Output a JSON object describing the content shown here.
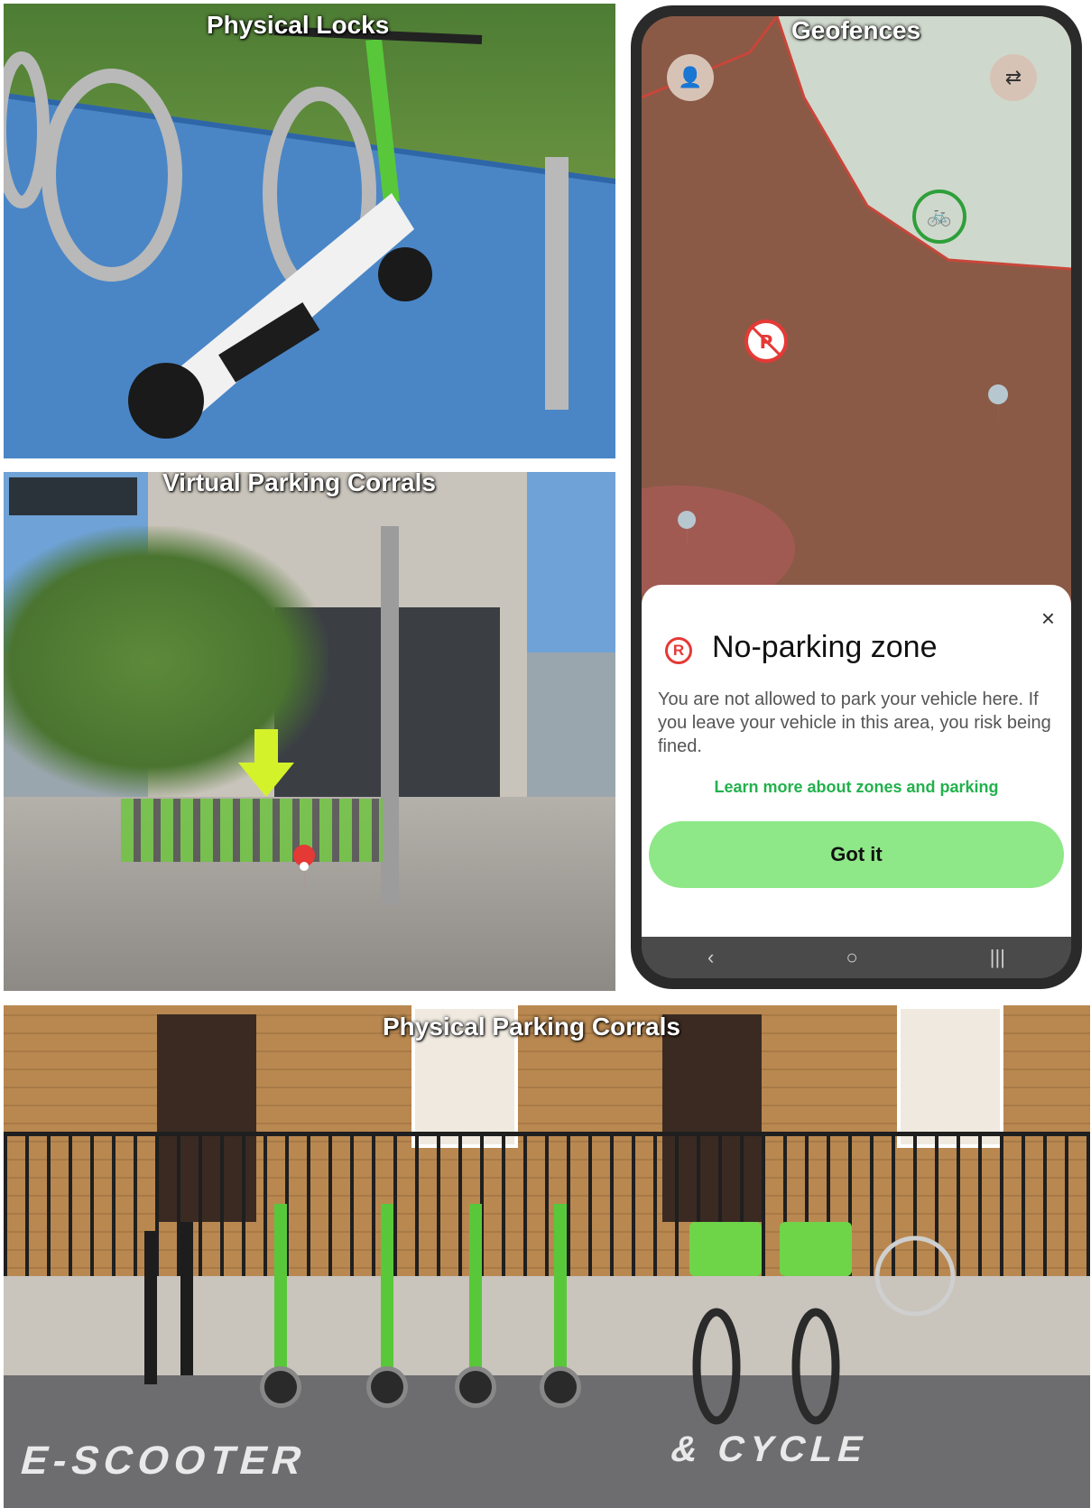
{
  "panels": {
    "physical_locks": {
      "caption": "Physical Locks"
    },
    "virtual_corrals": {
      "caption": "Virtual Parking Corrals"
    },
    "geofences": {
      "caption": "Geofences"
    },
    "physical_corrals": {
      "caption": "Physical Parking Corrals"
    }
  },
  "app": {
    "sheet": {
      "icon_glyph": "R",
      "title": "No-parking zone",
      "description": "You are not allowed to park your vehicle here. If you leave your vehicle in this area, you risk being fined.",
      "learn_more": "Learn more about zones and parking",
      "confirm_label": "Got it",
      "close_glyph": "×"
    },
    "map_icons": {
      "profile": "person-icon",
      "filter": "filter-icon",
      "bike": "bicycle-icon",
      "no_parking_pin": "no-parking-pin-icon",
      "location_pin": "location-pin-icon"
    },
    "navbar": {
      "back": "‹",
      "home": "○",
      "recents": "|||"
    }
  },
  "road_marking": {
    "left": "E-SCOOTER",
    "right": "& CYCLE"
  },
  "colors": {
    "accent_green": "#8ee888",
    "link_green": "#22b14c",
    "no_parking_red": "#e53935",
    "map_zone": "#8a5a46",
    "map_allowed": "#cfd8cc"
  }
}
